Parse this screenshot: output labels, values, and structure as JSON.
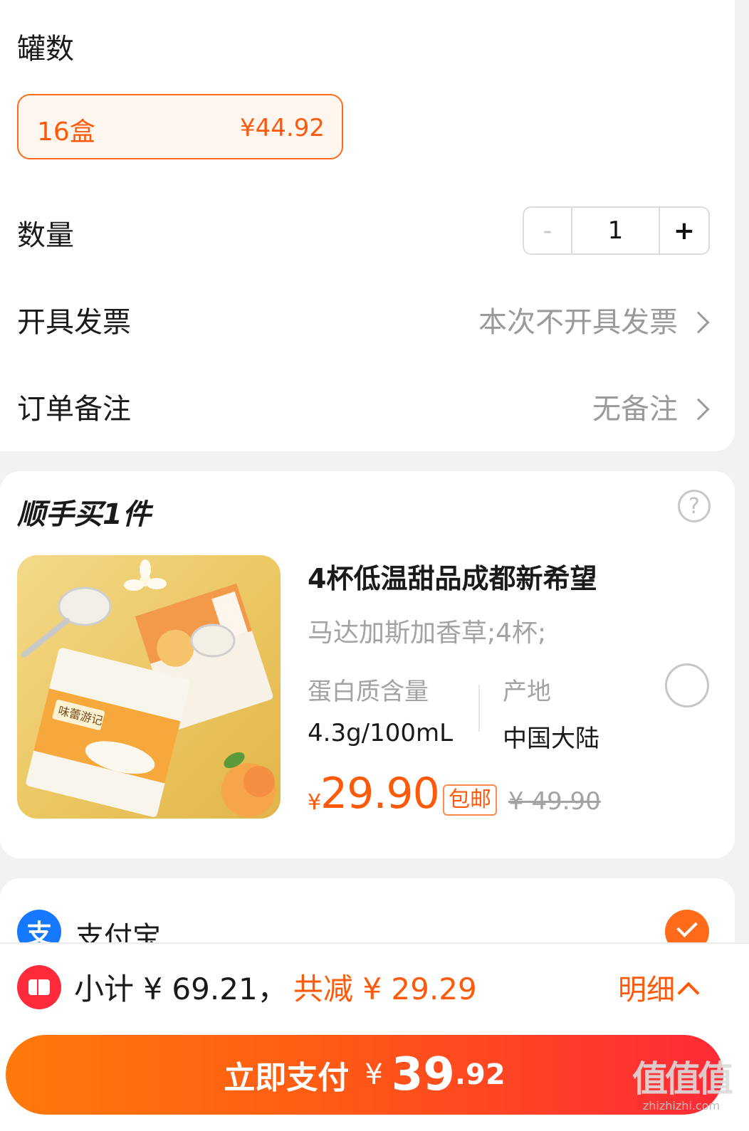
{
  "options": {
    "can_count_label": "罐数",
    "selected_option": {
      "name": "16盒",
      "price": "¥44.92"
    }
  },
  "quantity": {
    "label": "数量",
    "minus": "-",
    "value": "1",
    "plus": "+"
  },
  "invoice": {
    "label": "开具发票",
    "value": "本次不开具发票"
  },
  "remark": {
    "label": "订单备注",
    "value": "无备注"
  },
  "addon": {
    "title": "顺手买1件",
    "help_icon_text": "?",
    "product": {
      "title": "4杯低温甜品成都新希望",
      "spec": "马达加斯加香草;4杯;",
      "attrs": [
        {
          "key": "蛋白质含量",
          "value": "4.3g/100mL"
        },
        {
          "key": "产地",
          "value": "中国大陆"
        }
      ],
      "price_symbol": "¥",
      "price": "29.90",
      "free_shipping": "包邮",
      "original_price": "¥ 49.90",
      "image_brand_text": "味蕾游记"
    }
  },
  "payment": {
    "alipay_icon": "支",
    "alipay_label": "支付宝"
  },
  "summary": {
    "subtotal": "小计 ¥ 69.21，",
    "discount": "共减 ¥ 29.29",
    "detail": "明细"
  },
  "pay_button": {
    "label": "立即支付",
    "symbol": "¥",
    "amount_int": "39",
    "amount_dec": ".92"
  },
  "watermark": {
    "big": "值值值",
    "small": "zhizhizhi.com"
  },
  "colors": {
    "accent": "#ff5a0a",
    "alipay": "#1677ff",
    "coupon": "#ff2a3a"
  }
}
